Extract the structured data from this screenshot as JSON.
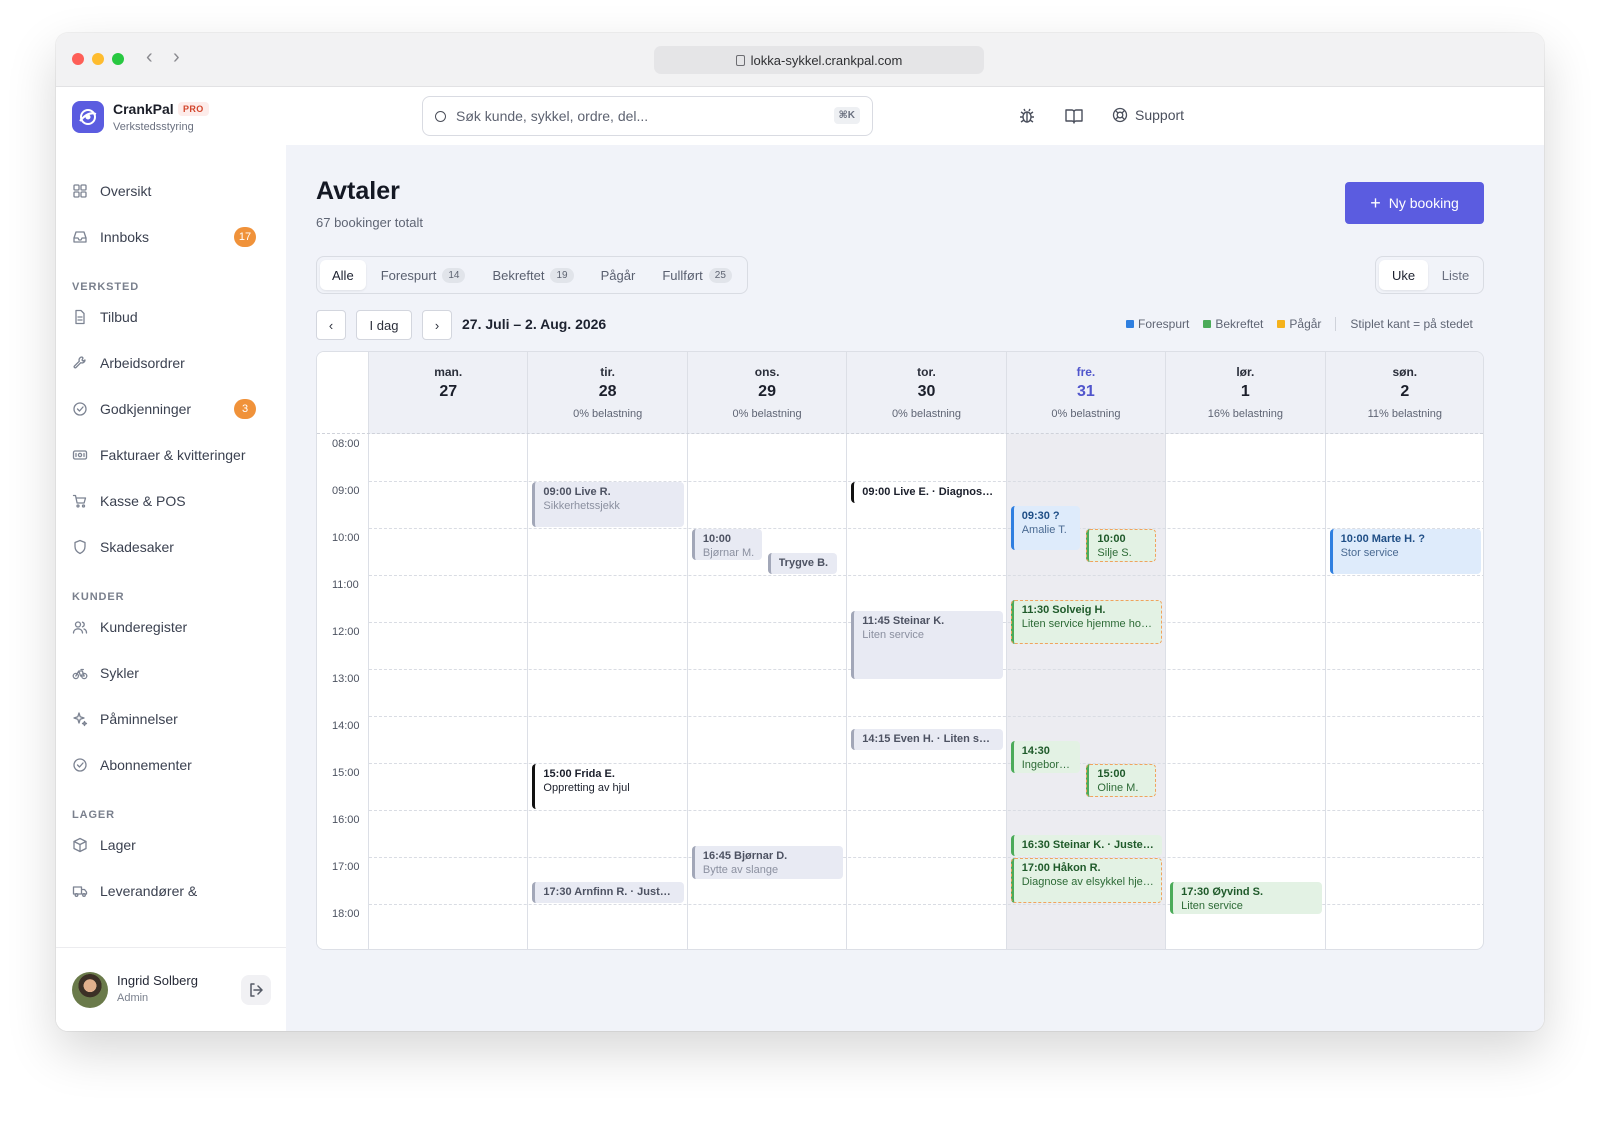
{
  "browser": {
    "url": "lokka-sykkel.crankpal.com"
  },
  "brand": {
    "name": "CrankPal",
    "badge": "PRO",
    "subtitle": "Verkstedsstyring"
  },
  "search": {
    "placeholder": "Søk kunde, sykkel, ordre, del...",
    "shortcut": "⌘K"
  },
  "topbar": {
    "support": "Support"
  },
  "sidebar": {
    "top": [
      {
        "label": "Oversikt",
        "icon": "grid-icon"
      },
      {
        "label": "Innboks",
        "icon": "inbox-icon",
        "badge": "17"
      }
    ],
    "sections": [
      {
        "title": "VERKSTED",
        "items": [
          {
            "label": "Tilbud",
            "icon": "document-icon"
          },
          {
            "label": "Arbeidsordrer",
            "icon": "wrench-icon"
          },
          {
            "label": "Godkjenninger",
            "icon": "check-circle-icon",
            "badge": "3"
          },
          {
            "label": "Fakturaer & kvitteringer",
            "icon": "receipt-icon"
          },
          {
            "label": "Kasse & POS",
            "icon": "cart-icon"
          },
          {
            "label": "Skadesaker",
            "icon": "shield-icon"
          }
        ]
      },
      {
        "title": "KUNDER",
        "items": [
          {
            "label": "Kunderegister",
            "icon": "users-icon"
          },
          {
            "label": "Sykler",
            "icon": "bicycle-icon"
          },
          {
            "label": "Påminnelser",
            "icon": "sparkle-icon"
          },
          {
            "label": "Abonnementer",
            "icon": "check-circle-icon"
          }
        ]
      },
      {
        "title": "LAGER",
        "items": [
          {
            "label": "Lager",
            "icon": "box-icon"
          },
          {
            "label": "Leverandører &",
            "icon": "truck-icon"
          }
        ]
      }
    ],
    "user": {
      "name": "Ingrid Solberg",
      "role": "Admin"
    }
  },
  "page": {
    "title": "Avtaler",
    "subtitle": "67 bookinger totalt",
    "new_button": "Ny booking",
    "filters": [
      {
        "label": "Alle",
        "count": "",
        "active": true
      },
      {
        "label": "Forespurt",
        "count": "14"
      },
      {
        "label": "Bekreftet",
        "count": "19"
      },
      {
        "label": "Pågår",
        "count": ""
      },
      {
        "label": "Fullført",
        "count": "25"
      }
    ],
    "views": {
      "week": "Uke",
      "list": "Liste"
    },
    "nav": {
      "prev": "‹",
      "today": "I dag",
      "next": "›"
    },
    "range": "27. Juli – 2. Aug. 2026",
    "legend": [
      {
        "label": "Forespurt",
        "color": "#2f7fe0"
      },
      {
        "label": "Bekreftet",
        "color": "#4bab59"
      },
      {
        "label": "Pågår",
        "color": "#f5b21c"
      }
    ],
    "legend_note": "Stiplet kant = på stedet"
  },
  "calendar": {
    "days": [
      {
        "name": "man.",
        "date": "27",
        "load": ""
      },
      {
        "name": "tir.",
        "date": "28",
        "load": "0% belastning"
      },
      {
        "name": "ons.",
        "date": "29",
        "load": "0% belastning"
      },
      {
        "name": "tor.",
        "date": "30",
        "load": "0% belastning"
      },
      {
        "name": "fre.",
        "date": "31",
        "load": "0% belastning",
        "today": true
      },
      {
        "name": "lør.",
        "date": "1",
        "load": "16% belastning"
      },
      {
        "name": "søn.",
        "date": "2",
        "load": "11% belastning"
      }
    ],
    "hours": [
      "08:00",
      "09:00",
      "10:00",
      "11:00",
      "12:00",
      "13:00",
      "14:00",
      "15:00",
      "16:00",
      "17:00",
      "18:00"
    ],
    "events": [
      {
        "day": 1,
        "start": 9.0,
        "end": 9.95,
        "lane": 0,
        "lanes": 1,
        "style": "grey",
        "title": "09:00 Live R.",
        "sub": "Sikkerhetssjekk"
      },
      {
        "day": 1,
        "start": 15.0,
        "end": 15.95,
        "lane": 0,
        "lanes": 1,
        "style": "black",
        "title": "15:00 Frida E.",
        "sub": "Oppretting av hjul"
      },
      {
        "day": 1,
        "start": 17.5,
        "end": 17.95,
        "lane": 0,
        "lanes": 1,
        "style": "grey",
        "title": "17:30 Arnfinn R. · Justeri...",
        "sub": ""
      },
      {
        "day": 2,
        "start": 10.0,
        "end": 10.65,
        "lane": 0,
        "lanes": 2,
        "style": "grey",
        "title": "10:00",
        "sub": "Bjørnar M."
      },
      {
        "day": 2,
        "start": 10.5,
        "end": 10.95,
        "lane": 1,
        "lanes": 2,
        "style": "grey",
        "title": "Trygve B.",
        "sub": ""
      },
      {
        "day": 2,
        "start": 16.75,
        "end": 17.45,
        "lane": 0,
        "lanes": 1,
        "style": "grey",
        "title": "16:45 Bjørnar D.",
        "sub": "Bytte av slange"
      },
      {
        "day": 3,
        "start": 9.0,
        "end": 9.45,
        "lane": 0,
        "lanes": 1,
        "style": "black",
        "title": "09:00 Live E. · Diagnose ...",
        "sub": ""
      },
      {
        "day": 3,
        "start": 11.75,
        "end": 13.2,
        "lane": 0,
        "lanes": 1,
        "style": "grey",
        "title": "11:45 Steinar K.",
        "sub": "Liten service"
      },
      {
        "day": 3,
        "start": 14.25,
        "end": 14.7,
        "lane": 0,
        "lanes": 1,
        "style": "grey",
        "title": "14:15 Even H. · Liten serv...",
        "sub": ""
      },
      {
        "day": 4,
        "start": 9.5,
        "end": 10.45,
        "lane": 0,
        "lanes": 2,
        "style": "blue",
        "title": "09:30 ?",
        "sub": "Amalie T."
      },
      {
        "day": 4,
        "start": 10.0,
        "end": 10.7,
        "lane": 1,
        "lanes": 2,
        "style": "green",
        "dashed": true,
        "title": "10:00",
        "sub": "Silje S."
      },
      {
        "day": 4,
        "start": 11.5,
        "end": 12.45,
        "lane": 0,
        "lanes": 1,
        "style": "green",
        "dashed": true,
        "title": "11:30 Solveig H.",
        "sub": "Liten service hjemme hos ..."
      },
      {
        "day": 4,
        "start": 14.5,
        "end": 15.2,
        "lane": 0,
        "lanes": 2,
        "style": "green",
        "title": "14:30",
        "sub": "Ingeborg A."
      },
      {
        "day": 4,
        "start": 15.0,
        "end": 15.7,
        "lane": 1,
        "lanes": 2,
        "style": "green",
        "dashed": true,
        "title": "15:00",
        "sub": "Oline M."
      },
      {
        "day": 4,
        "start": 16.5,
        "end": 16.95,
        "lane": 0,
        "lanes": 1,
        "style": "green",
        "title": "16:30 Steinar K. · Justerin...",
        "sub": ""
      },
      {
        "day": 4,
        "start": 17.0,
        "end": 17.95,
        "lane": 0,
        "lanes": 1,
        "style": "green",
        "dashed": true,
        "title": "17:00 Håkon R.",
        "sub": "Diagnose av elsykkel hjem..."
      },
      {
        "day": 5,
        "start": 17.5,
        "end": 18.2,
        "lane": 0,
        "lanes": 1,
        "style": "green",
        "title": "17:30 Øyvind S.",
        "sub": "Liten service"
      },
      {
        "day": 6,
        "start": 10.0,
        "end": 10.95,
        "lane": 0,
        "lanes": 1,
        "style": "blue",
        "title": "10:00 Marte H. ?",
        "sub": "Stor service"
      }
    ]
  }
}
